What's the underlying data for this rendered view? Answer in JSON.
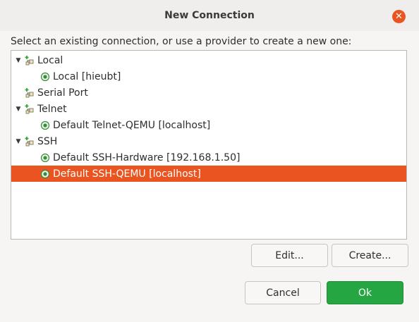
{
  "window": {
    "title": "New Connection"
  },
  "prompt": "Select an existing connection, or use a provider to create a new one:",
  "tree": {
    "items": [
      {
        "label": "Local",
        "level": 0,
        "kind": "provider",
        "expanded": true
      },
      {
        "label": "Local [hieubt]",
        "level": 1,
        "kind": "connection"
      },
      {
        "label": "Serial Port",
        "level": 0,
        "kind": "provider",
        "expanded": false
      },
      {
        "label": "Telnet",
        "level": 0,
        "kind": "provider",
        "expanded": true
      },
      {
        "label": "Default Telnet-QEMU [localhost]",
        "level": 1,
        "kind": "connection"
      },
      {
        "label": "SSH",
        "level": 0,
        "kind": "provider",
        "expanded": true
      },
      {
        "label": "Default SSH-Hardware [192.168.1.50]",
        "level": 1,
        "kind": "connection"
      },
      {
        "label": "Default SSH-QEMU [localhost]",
        "level": 1,
        "kind": "connection",
        "selected": true
      }
    ]
  },
  "buttons": {
    "edit": "Edit...",
    "create": "Create...",
    "cancel": "Cancel",
    "ok": "Ok"
  },
  "colors": {
    "selection": "#e95420",
    "ok_button": "#26a642",
    "close_button": "#e95420"
  },
  "icons": {
    "close": "close-icon",
    "expander": "chevron-down-icon",
    "provider": "provider-icon",
    "connection": "connection-icon"
  }
}
